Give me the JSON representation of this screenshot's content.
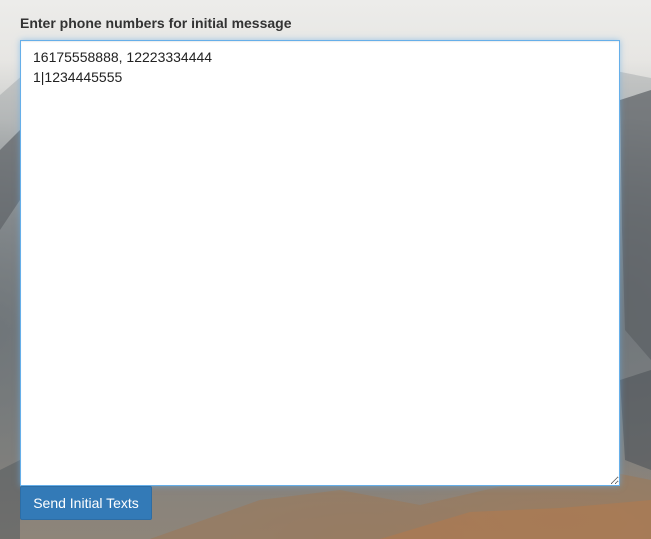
{
  "form": {
    "label": "Enter phone numbers for initial message",
    "textarea_value": "16175558888, 12223334444\n1|1234445555",
    "send_button_label": "Send Initial Texts"
  },
  "colors": {
    "accent": "#337ab7",
    "focus_border": "#66afe9",
    "label_text": "#333333"
  }
}
